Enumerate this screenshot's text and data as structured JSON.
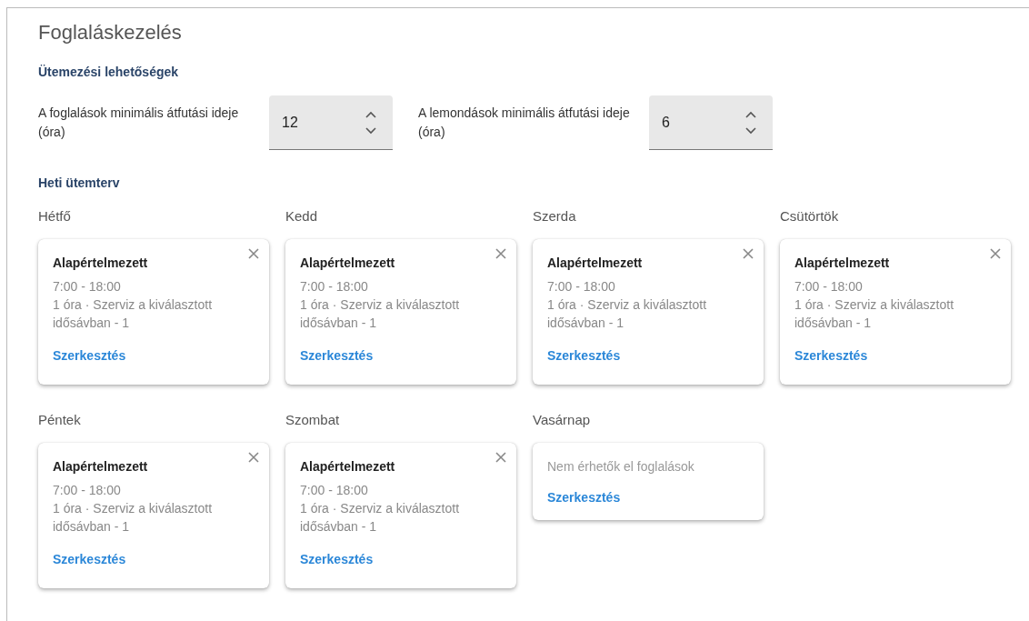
{
  "title": "Foglaláskezelés",
  "scheduling": {
    "heading": "Ütemezési lehetőségek",
    "fields": [
      {
        "label": "A foglalások minimális átfutási ideje (óra)",
        "value": "12"
      },
      {
        "label": "A lemondások minimális átfutási ideje (óra)",
        "value": "6"
      }
    ]
  },
  "weekly": {
    "heading": "Heti ütemterv",
    "days": [
      {
        "name": "Hétfő",
        "kind": "slots",
        "title": "Alapértelmezett",
        "time": "7:00 - 18:00",
        "detail": "1 óra · Szerviz a kiválasztott idősávban - 1",
        "link": "Szerkesztés"
      },
      {
        "name": "Kedd",
        "kind": "slots",
        "title": "Alapértelmezett",
        "time": "7:00 - 18:00",
        "detail": "1 óra · Szerviz a kiválasztott idősávban - 1",
        "link": "Szerkesztés"
      },
      {
        "name": "Szerda",
        "kind": "slots",
        "title": "Alapértelmezett",
        "time": "7:00 - 18:00",
        "detail": "1 óra · Szerviz a kiválasztott idősávban - 1",
        "link": "Szerkesztés"
      },
      {
        "name": "Csütörtök",
        "kind": "slots",
        "title": "Alapértelmezett",
        "time": "7:00 - 18:00",
        "detail": "1 óra · Szerviz a kiválasztott idősávban - 1",
        "link": "Szerkesztés"
      },
      {
        "name": "Péntek",
        "kind": "slots",
        "title": "Alapértelmezett",
        "time": "7:00 - 18:00",
        "detail": "1 óra · Szerviz a kiválasztott idősávban - 1",
        "link": "Szerkesztés"
      },
      {
        "name": "Szombat",
        "kind": "slots",
        "title": "Alapértelmezett",
        "time": "7:00 - 18:00",
        "detail": "1 óra · Szerviz a kiválasztott idősávban - 1",
        "link": "Szerkesztés"
      },
      {
        "name": "Vasárnap",
        "kind": "empty",
        "message": "Nem érhetők el foglalások",
        "link": "Szerkesztés"
      }
    ]
  }
}
